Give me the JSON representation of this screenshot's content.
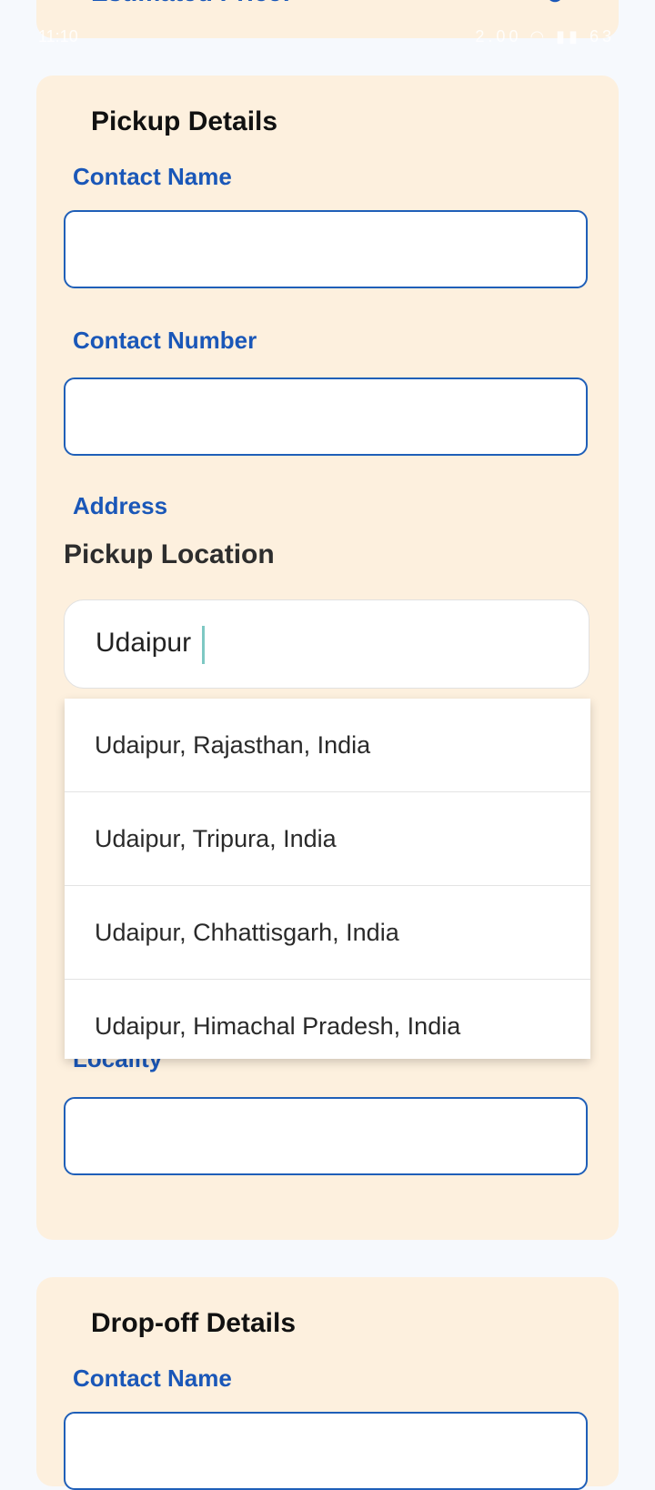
{
  "top_card": {
    "title": "Estimated Price:",
    "icon": "refresh-icon"
  },
  "status_bar": {
    "time": "11:10",
    "icons": "2.00 ◠ ▮▮ 63"
  },
  "pickup": {
    "section_title": "Pickup Details",
    "contact_name_label": "Contact Name",
    "contact_name_value": "",
    "contact_number_label": "Contact Number",
    "contact_number_value": "",
    "address_label": "Address",
    "location_heading": "Pickup Location",
    "location_value": "Udaipur",
    "suggestions": [
      "Udaipur, Rajasthan, India",
      "Udaipur, Tripura, India",
      "Udaipur, Chhattisgarh, India",
      "Udaipur, Himachal Pradesh, India"
    ],
    "locality_label": "Locality",
    "locality_value": ""
  },
  "dropoff": {
    "section_title": "Drop-off Details",
    "contact_name_label": "Contact Name",
    "contact_name_value": ""
  },
  "colors": {
    "card_background": "#fdf0de",
    "label_blue": "#1a57b8",
    "page_background": "#f6f9fd"
  }
}
